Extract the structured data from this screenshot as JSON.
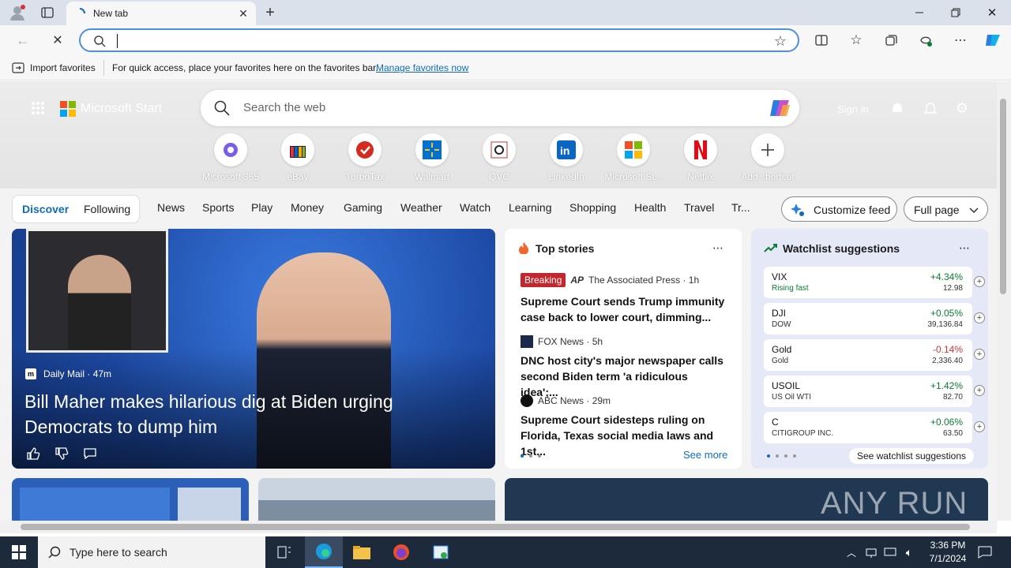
{
  "browser": {
    "tab_title": "New tab",
    "address_value": "",
    "favbar": {
      "import": "Import favorites",
      "message": "For quick access, place your favorites here on the favorites bar.",
      "manage_link": "Manage favorites now"
    }
  },
  "msn": {
    "brand": "Microsoft Start",
    "search_placeholder": "Search the web",
    "signin": "Sign in",
    "shortcuts": [
      {
        "label": "Microsoft 365",
        "icon": "m365-icon"
      },
      {
        "label": "eBay",
        "icon": "ebay-icon"
      },
      {
        "label": "TurboTax",
        "icon": "turbotax-icon"
      },
      {
        "label": "Walmart",
        "icon": "walmart-icon"
      },
      {
        "label": "QVC",
        "icon": "qvc-icon"
      },
      {
        "label": "LinkedIn",
        "icon": "linkedin-icon"
      },
      {
        "label": "Microsoft St...",
        "icon": "microsoft-store-icon"
      },
      {
        "label": "Netflix",
        "icon": "netflix-icon"
      },
      {
        "label": "Add shortcut",
        "icon": "plus-icon"
      }
    ],
    "nav": {
      "discover": "Discover",
      "following": "Following",
      "items": [
        "News",
        "Sports",
        "Play",
        "Money",
        "Gaming",
        "Weather",
        "Watch",
        "Learning",
        "Shopping",
        "Health",
        "Travel",
        "Tr..."
      ],
      "customize": "Customize feed",
      "layout": "Full page"
    },
    "hero": {
      "source": "Daily Mail",
      "age": "47m",
      "headline": "Bill Maher makes hilarious dig at Biden urging Democrats to dump him"
    },
    "top_stories": {
      "title": "Top stories",
      "see_more": "See more",
      "items": [
        {
          "badge": "Breaking",
          "source": "The Associated Press",
          "age": "1h",
          "headline": "Supreme Court sends Trump immunity case back to lower court, dimming..."
        },
        {
          "source": "FOX News",
          "age": "5h",
          "headline": "DNC host city's major newspaper calls second Biden term 'a ridiculous idea';..."
        },
        {
          "source": "ABC News",
          "age": "29m",
          "headline": "Supreme Court sidesteps ruling on Florida, Texas social media laws and 1st..."
        }
      ]
    },
    "watchlist": {
      "title": "Watchlist suggestions",
      "see_link": "See watchlist suggestions",
      "rows": [
        {
          "symbol": "VIX",
          "name": "Rising fast",
          "change": "+4.34%",
          "price": "12.98",
          "up": true
        },
        {
          "symbol": "DJI",
          "name": "DOW",
          "change": "+0.05%",
          "price": "39,136.84",
          "up": true
        },
        {
          "symbol": "Gold",
          "name": "Gold",
          "change": "-0.14%",
          "price": "2,336.40",
          "up": false
        },
        {
          "symbol": "USOIL",
          "name": "US Oil WTI",
          "change": "+1.42%",
          "price": "82.70",
          "up": true
        },
        {
          "symbol": "C",
          "name": "CITIGROUP INC.",
          "change": "+0.06%",
          "price": "63.50",
          "up": true
        }
      ]
    },
    "watermark": "ANY RUN"
  },
  "taskbar": {
    "search_placeholder": "Type here to search",
    "time": "3:36 PM",
    "date": "7/1/2024"
  },
  "colors": {
    "accent": "#0f6cbd",
    "up": "#0a7d32",
    "down": "#d13438",
    "breaking": "#c4262e"
  }
}
